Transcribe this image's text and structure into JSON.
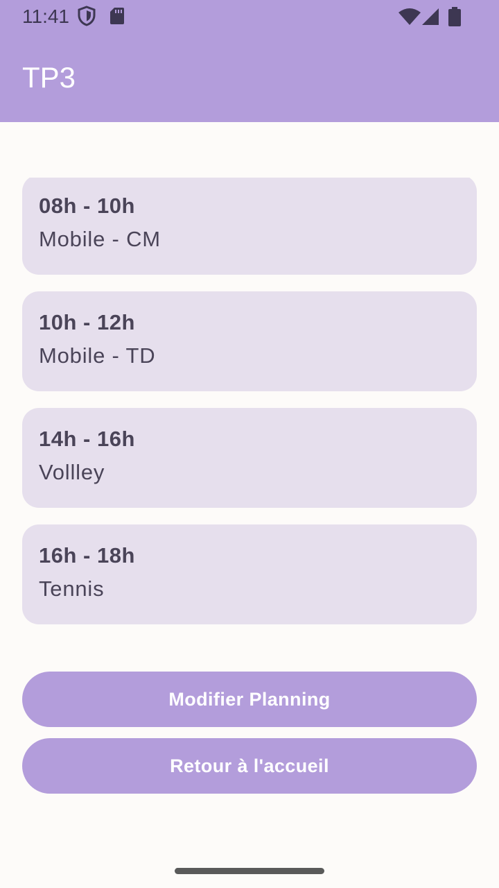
{
  "status_bar": {
    "time": "11:41",
    "icons": [
      "shield-icon",
      "sd-card-icon",
      "wifi-icon",
      "signal-icon",
      "battery-icon"
    ]
  },
  "app_bar": {
    "title": "TP3"
  },
  "planning": {
    "items": [
      {
        "time": "08h - 10h",
        "subject": "Mobile - CM"
      },
      {
        "time": "10h - 12h",
        "subject": "Mobile - TD"
      },
      {
        "time": "14h - 16h",
        "subject": "Vollley"
      },
      {
        "time": "16h - 18h",
        "subject": "Tennis"
      }
    ]
  },
  "buttons": {
    "edit_label": "Modifier Planning",
    "back_label": "Retour à l'accueil"
  },
  "colors": {
    "primary": "#b39ddb",
    "card": "#e6dfed",
    "background": "#fdfbf9",
    "text": "#4a4458"
  }
}
